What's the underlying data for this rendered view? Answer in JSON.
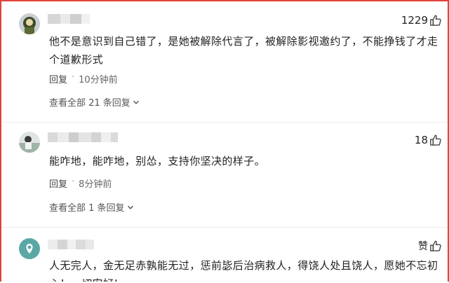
{
  "comments": [
    {
      "likes": "1229",
      "text": "他不是意识到自己错了，是她被解除代言了，被解除影视邀约了，不能挣钱了才走个道歉形式",
      "reply_label": "回复",
      "time": "10分钟前",
      "more_replies": "查看全部 21 条回复"
    },
    {
      "likes": "18",
      "text": "能咋地，能咋地，别怂，支持你坚决的样子。",
      "reply_label": "回复",
      "time": "8分钟前",
      "more_replies": "查看全部 1 条回复"
    },
    {
      "likes": "赞",
      "text": "人无完人，金无足赤孰能无过，惩前毖后治病救人，得饶人处且饶人，愿她不忘初心！一切安好!"
    }
  ],
  "separator": "·",
  "icons": {
    "like": "thumbs-up-icon",
    "expand": "chevron-down-icon"
  },
  "colors": {
    "border": "#e0443a",
    "text": "#222222",
    "meta": "#666666"
  }
}
